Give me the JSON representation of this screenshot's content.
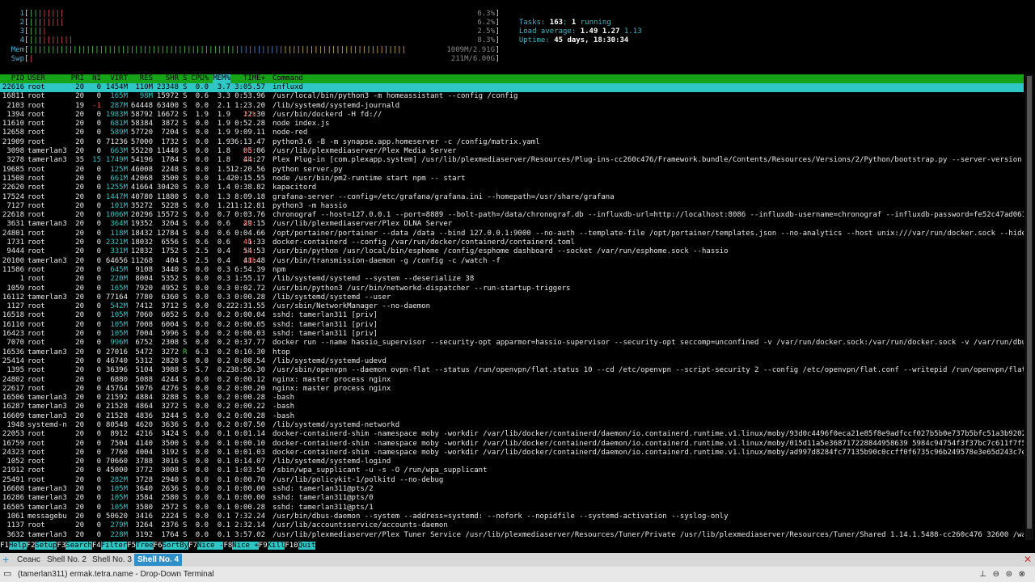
{
  "meters": {
    "cpus": [
      {
        "label": "1",
        "value": "6.3%"
      },
      {
        "label": "2",
        "value": "6.2%"
      },
      {
        "label": "3",
        "value": "2.5%"
      },
      {
        "label": "4",
        "value": "8.3%"
      }
    ],
    "mem": {
      "label": "Mem",
      "value": "1009M/2.91G"
    },
    "swp": {
      "label": "Swp",
      "value": "211M/6.00G"
    }
  },
  "info": {
    "tasks_label": "Tasks:",
    "tasks_count": "163",
    "tasks_sep": ";",
    "running_count": "1",
    "running_label": "running",
    "load_label": "Load average:",
    "load1": "1.49",
    "load5": "1.27",
    "load15": "1.13",
    "uptime_label": "Uptime:",
    "uptime_value": "45 days, 18:30:34"
  },
  "header": {
    "pid": "PID",
    "user": "USER",
    "pri": "PRI",
    "ni": "NI",
    "virt": "VIRT",
    "res": "RES",
    "shr": "SHR",
    "s": "S",
    "cpu": "CPU%",
    "mem": "MEM%",
    "time": "TIME+",
    "command": "Command"
  },
  "processes": [
    {
      "pid": "22616",
      "user": "root",
      "pri": "20",
      "ni": "0",
      "virt": "1454M",
      "res": "110M",
      "shr": "23348",
      "s": "S",
      "cpu": "0.0",
      "mem": "3.7",
      "time": "3:05.57",
      "cmd": "influxd"
    },
    {
      "pid": "16811",
      "user": "root",
      "pri": "20",
      "ni": "0",
      "virt": "165M",
      "res": "98M",
      "shr": "15972",
      "s": "S",
      "cpu": "0.6",
      "mem": "3.3",
      "time": "0:53.96",
      "cmd": "/usr/local/bin/python3 -m homeassistant --config /config"
    },
    {
      "pid": "2103",
      "user": "root",
      "pri": "19",
      "ni": "-1",
      "virt": "287M",
      "res": "64448",
      "shr": "63400",
      "s": "S",
      "cpu": "0.0",
      "mem": "2.1",
      "time": "1:23.20",
      "cmd": "/lib/systemd/systemd-journald"
    },
    {
      "pid": "1394",
      "user": "root",
      "pri": "20",
      "ni": "0",
      "virt": "1983M",
      "res": "58792",
      "shr": "16672",
      "s": "S",
      "cpu": "1.9",
      "mem": "1.9",
      "time": "21h12:30",
      "cmd": "/usr/bin/dockerd -H fd://"
    },
    {
      "pid": "11610",
      "user": "root",
      "pri": "20",
      "ni": "0",
      "virt": "681M",
      "res": "58384",
      "shr": "3872",
      "s": "S",
      "cpu": "0.0",
      "mem": "1.9",
      "time": "0:52.28",
      "cmd": "node index.js"
    },
    {
      "pid": "12658",
      "user": "root",
      "pri": "20",
      "ni": "0",
      "virt": "589M",
      "res": "57720",
      "shr": "7204",
      "s": "S",
      "cpu": "0.0",
      "mem": "1.9",
      "time": "9:09.11",
      "cmd": "node-red"
    },
    {
      "pid": "21909",
      "user": "root",
      "pri": "20",
      "ni": "0",
      "virt": "71236",
      "res": "57000",
      "shr": "1732",
      "s": "S",
      "cpu": "0.0",
      "mem": "1.9",
      "time": "36:13.47",
      "cmd": "python3.6 -B -m synapse.app.homeserver -c /config/matrix.yaml"
    },
    {
      "pid": "3098",
      "user": "tamerlan3",
      "pri": "20",
      "ni": "0",
      "virt": "663M",
      "res": "55220",
      "shr": "11440",
      "s": "S",
      "cpu": "0.0",
      "mem": "1.8",
      "time": "3h05:06",
      "cmd": "/usr/lib/plexmediaserver/Plex Media Server"
    },
    {
      "pid": "3278",
      "user": "tamerlan3",
      "pri": "35",
      "ni": "15",
      "virt": "1749M",
      "res": "54196",
      "shr": "1784",
      "s": "S",
      "cpu": "0.0",
      "mem": "1.8",
      "time": "2h44:27",
      "cmd": "Plex Plug-in [com.plexapp.system] /usr/lib/plexmediaserver/Resources/Plug-ins-cc260c476/Framework.bundle/Contents/Resources/Versions/2/Python/bootstrap.py --server-version 1."
    },
    {
      "pid": "19685",
      "user": "root",
      "pri": "20",
      "ni": "0",
      "virt": "125M",
      "res": "46008",
      "shr": "2248",
      "s": "S",
      "cpu": "0.0",
      "mem": "1.5",
      "time": "12:20.56",
      "cmd": "python server.py"
    },
    {
      "pid": "11508",
      "user": "root",
      "pri": "20",
      "ni": "0",
      "virt": "661M",
      "res": "42068",
      "shr": "3500",
      "s": "S",
      "cpu": "0.0",
      "mem": "1.4",
      "time": "20:15.55",
      "cmd": "node /usr/bin/pm2-runtime start npm -- start"
    },
    {
      "pid": "22620",
      "user": "root",
      "pri": "20",
      "ni": "0",
      "virt": "1255M",
      "res": "41664",
      "shr": "30420",
      "s": "S",
      "cpu": "0.0",
      "mem": "1.4",
      "time": "0:38.82",
      "cmd": "kapacitord"
    },
    {
      "pid": "17524",
      "user": "root",
      "pri": "20",
      "ni": "0",
      "virt": "1447M",
      "res": "40780",
      "shr": "11880",
      "s": "S",
      "cpu": "0.0",
      "mem": "1.3",
      "time": "8:09.18",
      "cmd": "grafana-server --config=/etc/grafana/grafana.ini --homepath=/usr/share/grafana"
    },
    {
      "pid": "7127",
      "user": "root",
      "pri": "20",
      "ni": "0",
      "virt": "101M",
      "res": "35272",
      "shr": "5228",
      "s": "S",
      "cpu": "0.0",
      "mem": "1.2",
      "time": "11:12.81",
      "cmd": "python3 -m hassio"
    },
    {
      "pid": "22618",
      "user": "root",
      "pri": "20",
      "ni": "0",
      "virt": "1006M",
      "res": "20296",
      "shr": "15572",
      "s": "S",
      "cpu": "0.0",
      "mem": "0.7",
      "time": "0:03.76",
      "cmd": "chronograf --host=127.0.0.1 --port=8889 --bolt-path=/data/chronograf.db --influxdb-url=http://localhost:8086 --influxdb-username=chronograf --influxdb-password=fe52c47ad06147"
    },
    {
      "pid": "3631",
      "user": "tamerlan3",
      "pri": "20",
      "ni": "0",
      "virt": "364M",
      "res": "19352",
      "shr": "3204",
      "s": "S",
      "cpu": "0.0",
      "mem": "0.6",
      "time": "4h29:15",
      "cmd": "/usr/lib/plexmediaserver/Plex DLNA Server"
    },
    {
      "pid": "24801",
      "user": "root",
      "pri": "20",
      "ni": "0",
      "virt": "118M",
      "res": "18432",
      "shr": "12784",
      "s": "S",
      "cpu": "0.0",
      "mem": "0.6",
      "time": "0:04.66",
      "cmd": "/opt/portainer/portainer --data /data --bind 127.0.0.1:9000 --no-auth --template-file /opt/portainer/templates.json --no-analytics --host unix:///var/run/docker.sock --hide-l"
    },
    {
      "pid": "1731",
      "user": "root",
      "pri": "20",
      "ni": "0",
      "virt": "2321M",
      "res": "18032",
      "shr": "6556",
      "s": "S",
      "cpu": "0.6",
      "mem": "0.6",
      "time": "4h41:33",
      "cmd": "docker-containerd --config /var/run/docker/containerd/containerd.toml"
    },
    {
      "pid": "9444",
      "user": "root",
      "pri": "20",
      "ni": "0",
      "virt": "331M",
      "res": "12832",
      "shr": "1752",
      "s": "S",
      "cpu": "2.5",
      "mem": "0.4",
      "time": "1h54:53",
      "cmd": "/usr/bin/python /usr/local/bin/esphome /config/esphome dashboard --socket /var/run/esphome.sock --hassio"
    },
    {
      "pid": "20100",
      "user": "tamerlan3",
      "pri": "20",
      "ni": "0",
      "virt": "64656",
      "res": "11268",
      "shr": "404",
      "s": "S",
      "cpu": "2.5",
      "mem": "0.4",
      "time": "18h41:48",
      "cmd": "/usr/bin/transmission-daemon -g /config -c /watch -f"
    },
    {
      "pid": "11586",
      "user": "root",
      "pri": "20",
      "ni": "0",
      "virt": "645M",
      "res": "9108",
      "shr": "3440",
      "s": "S",
      "cpu": "0.0",
      "mem": "0.3",
      "time": "6:54.39",
      "cmd": "npm"
    },
    {
      "pid": "1",
      "user": "root",
      "pri": "20",
      "ni": "0",
      "virt": "220M",
      "res": "8004",
      "shr": "5352",
      "s": "S",
      "cpu": "0.0",
      "mem": "0.3",
      "time": "1:55.17",
      "cmd": "/lib/systemd/systemd --system --deserialize 38"
    },
    {
      "pid": "1059",
      "user": "root",
      "pri": "20",
      "ni": "0",
      "virt": "165M",
      "res": "7920",
      "shr": "4952",
      "s": "S",
      "cpu": "0.0",
      "mem": "0.3",
      "time": "0:02.72",
      "cmd": "/usr/bin/python3 /usr/bin/networkd-dispatcher --run-startup-triggers"
    },
    {
      "pid": "16112",
      "user": "tamerlan3",
      "pri": "20",
      "ni": "0",
      "virt": "77164",
      "res": "7780",
      "shr": "6360",
      "s": "S",
      "cpu": "0.0",
      "mem": "0.3",
      "time": "0:00.28",
      "cmd": "/lib/systemd/systemd --user"
    },
    {
      "pid": "1127",
      "user": "root",
      "pri": "20",
      "ni": "0",
      "virt": "542M",
      "res": "7412",
      "shr": "3712",
      "s": "S",
      "cpu": "0.0",
      "mem": "0.2",
      "time": "22:31.55",
      "cmd": "/usr/sbin/NetworkManager --no-daemon"
    },
    {
      "pid": "16518",
      "user": "root",
      "pri": "20",
      "ni": "0",
      "virt": "105M",
      "res": "7060",
      "shr": "6052",
      "s": "S",
      "cpu": "0.0",
      "mem": "0.2",
      "time": "0:00.04",
      "cmd": "sshd: tamerlan311 [priv]"
    },
    {
      "pid": "16110",
      "user": "root",
      "pri": "20",
      "ni": "0",
      "virt": "105M",
      "res": "7008",
      "shr": "6004",
      "s": "S",
      "cpu": "0.0",
      "mem": "0.2",
      "time": "0:00.05",
      "cmd": "sshd: tamerlan311 [priv]"
    },
    {
      "pid": "16423",
      "user": "root",
      "pri": "20",
      "ni": "0",
      "virt": "105M",
      "res": "7004",
      "shr": "5996",
      "s": "S",
      "cpu": "0.0",
      "mem": "0.2",
      "time": "0:00.03",
      "cmd": "sshd: tamerlan311 [priv]"
    },
    {
      "pid": "7070",
      "user": "root",
      "pri": "20",
      "ni": "0",
      "virt": "996M",
      "res": "6752",
      "shr": "2308",
      "s": "S",
      "cpu": "0.0",
      "mem": "0.2",
      "time": "0:37.77",
      "cmd": "docker run --name hassio_supervisor --security-opt apparmor=hassio-supervisor --security-opt seccomp=unconfined -v /var/run/docker.sock:/var/run/docker.sock -v /var/run/dbus:"
    },
    {
      "pid": "16536",
      "user": "tamerlan3",
      "pri": "20",
      "ni": "0",
      "virt": "27016",
      "res": "5472",
      "shr": "3272",
      "s": "R",
      "cpu": "6.3",
      "mem": "0.2",
      "time": "0:10.30",
      "cmd": "htop"
    },
    {
      "pid": "25414",
      "user": "root",
      "pri": "20",
      "ni": "0",
      "virt": "46740",
      "res": "5312",
      "shr": "2820",
      "s": "S",
      "cpu": "0.0",
      "mem": "0.2",
      "time": "0:08.54",
      "cmd": "/lib/systemd/systemd-udevd"
    },
    {
      "pid": "1395",
      "user": "root",
      "pri": "20",
      "ni": "0",
      "virt": "36396",
      "res": "5104",
      "shr": "3988",
      "s": "S",
      "cpu": "5.7",
      "mem": "0.2",
      "time": "38:56.30",
      "cmd": "/usr/sbin/openvpn --daemon ovpn-flat --status /run/openvpn/flat.status 10 --cd /etc/openvpn --script-security 2 --config /etc/openvpn/flat.conf --writepid /run/openvpn/flat.p"
    },
    {
      "pid": "24802",
      "user": "root",
      "pri": "20",
      "ni": "0",
      "virt": "6880",
      "res": "5088",
      "shr": "4244",
      "s": "S",
      "cpu": "0.0",
      "mem": "0.2",
      "time": "0:00.12",
      "cmd": "nginx: master process nginx"
    },
    {
      "pid": "22617",
      "user": "root",
      "pri": "20",
      "ni": "0",
      "virt": "45764",
      "res": "5076",
      "shr": "4276",
      "s": "S",
      "cpu": "0.0",
      "mem": "0.2",
      "time": "0:00.20",
      "cmd": "nginx: master process nginx"
    },
    {
      "pid": "16506",
      "user": "tamerlan3",
      "pri": "20",
      "ni": "0",
      "virt": "21592",
      "res": "4884",
      "shr": "3288",
      "s": "S",
      "cpu": "0.0",
      "mem": "0.2",
      "time": "0:00.28",
      "cmd": "-bash"
    },
    {
      "pid": "16287",
      "user": "tamerlan3",
      "pri": "20",
      "ni": "0",
      "virt": "21528",
      "res": "4864",
      "shr": "3272",
      "s": "S",
      "cpu": "0.0",
      "mem": "0.2",
      "time": "0:00.22",
      "cmd": "-bash"
    },
    {
      "pid": "16609",
      "user": "tamerlan3",
      "pri": "20",
      "ni": "0",
      "virt": "21528",
      "res": "4836",
      "shr": "3244",
      "s": "S",
      "cpu": "0.0",
      "mem": "0.2",
      "time": "0:00.28",
      "cmd": "-bash"
    },
    {
      "pid": "1948",
      "user": "systemd-n",
      "pri": "20",
      "ni": "0",
      "virt": "80548",
      "res": "4620",
      "shr": "3636",
      "s": "S",
      "cpu": "0.0",
      "mem": "0.2",
      "time": "0:07.50",
      "cmd": "/lib/systemd/systemd-networkd"
    },
    {
      "pid": "22053",
      "user": "root",
      "pri": "20",
      "ni": "0",
      "virt": "8912",
      "res": "4216",
      "shr": "3424",
      "s": "S",
      "cpu": "0.0",
      "mem": "0.1",
      "time": "0:01.14",
      "cmd": "docker-containerd-shim -namespace moby -workdir /var/lib/docker/containerd/daemon/io.containerd.runtime.v1.linux/moby/93d0c4496f0eca21e85f8e9adfccf027b5b0e737b5bfc51a3b920200"
    },
    {
      "pid": "16759",
      "user": "root",
      "pri": "20",
      "ni": "0",
      "virt": "7504",
      "res": "4140",
      "shr": "3500",
      "s": "S",
      "cpu": "0.0",
      "mem": "0.1",
      "time": "0:00.10",
      "cmd": "docker-containerd-shim -namespace moby -workdir /var/lib/docker/containerd/daemon/io.containerd.runtime.v1.linux/moby/015d11a5e368717228844958639 5984c94754f3f37bc7c611f7f528"
    },
    {
      "pid": "24323",
      "user": "root",
      "pri": "20",
      "ni": "0",
      "virt": "7760",
      "res": "4004",
      "shr": "3192",
      "s": "S",
      "cpu": "0.0",
      "mem": "0.1",
      "time": "0:01.03",
      "cmd": "docker-containerd-shim -namespace moby -workdir /var/lib/docker/containerd/daemon/io.containerd.runtime.v1.linux/moby/ad997d8284fc77135b90c0ccff0f6735c96b249578e3e65d243c7e70"
    },
    {
      "pid": "1052",
      "user": "root",
      "pri": "20",
      "ni": "0",
      "virt": "70660",
      "res": "3788",
      "shr": "3016",
      "s": "S",
      "cpu": "0.0",
      "mem": "0.1",
      "time": "0:14.07",
      "cmd": "/lib/systemd/systemd-logind"
    },
    {
      "pid": "21912",
      "user": "root",
      "pri": "20",
      "ni": "0",
      "virt": "45000",
      "res": "3772",
      "shr": "3008",
      "s": "S",
      "cpu": "0.0",
      "mem": "0.1",
      "time": "1:03.50",
      "cmd": "/sbin/wpa_supplicant -u -s -O /run/wpa_supplicant"
    },
    {
      "pid": "25491",
      "user": "root",
      "pri": "20",
      "ni": "0",
      "virt": "282M",
      "res": "3728",
      "shr": "2940",
      "s": "S",
      "cpu": "0.0",
      "mem": "0.1",
      "time": "0:00.70",
      "cmd": "/usr/lib/policykit-1/polkitd --no-debug"
    },
    {
      "pid": "16608",
      "user": "tamerlan3",
      "pri": "20",
      "ni": "0",
      "virt": "105M",
      "res": "3640",
      "shr": "2636",
      "s": "S",
      "cpu": "0.0",
      "mem": "0.1",
      "time": "0:00.00",
      "cmd": "sshd: tamerlan311@pts/2"
    },
    {
      "pid": "16286",
      "user": "tamerlan3",
      "pri": "20",
      "ni": "0",
      "virt": "105M",
      "res": "3584",
      "shr": "2580",
      "s": "S",
      "cpu": "0.0",
      "mem": "0.1",
      "time": "0:00.00",
      "cmd": "sshd: tamerlan311@pts/0"
    },
    {
      "pid": "16505",
      "user": "tamerlan3",
      "pri": "20",
      "ni": "0",
      "virt": "105M",
      "res": "3580",
      "shr": "2572",
      "s": "S",
      "cpu": "0.0",
      "mem": "0.1",
      "time": "0:00.28",
      "cmd": "sshd: tamerlan311@pts/1"
    },
    {
      "pid": "1061",
      "user": "messagebu",
      "pri": "20",
      "ni": "0",
      "virt": "50620",
      "res": "3416",
      "shr": "2224",
      "s": "S",
      "cpu": "0.0",
      "mem": "0.1",
      "time": "7:32.24",
      "cmd": "/usr/bin/dbus-daemon --system --address=systemd: --nofork --nopidfile --systemd-activation --syslog-only"
    },
    {
      "pid": "1137",
      "user": "root",
      "pri": "20",
      "ni": "0",
      "virt": "279M",
      "res": "3264",
      "shr": "2376",
      "s": "S",
      "cpu": "0.0",
      "mem": "0.1",
      "time": "2:32.14",
      "cmd": "/usr/lib/accountsservice/accounts-daemon"
    },
    {
      "pid": "3632",
      "user": "tamerlan3",
      "pri": "20",
      "ni": "0",
      "virt": "228M",
      "res": "3192",
      "shr": "1764",
      "s": "S",
      "cpu": "0.0",
      "mem": "0.1",
      "time": "3:57.02",
      "cmd": "/usr/lib/plexmediaserver/Plex Tuner Service /usr/lib/plexmediaserver/Resources/Tuner/Private /usr/lib/plexmediaserver/Resources/Tuner/Shared 1.14.1.5488-cc260c476 32600 /wait"
    }
  ],
  "fkeys": [
    {
      "num": "F1",
      "label": "Help"
    },
    {
      "num": "F2",
      "label": "Setup"
    },
    {
      "num": "F3",
      "label": "Search"
    },
    {
      "num": "F4",
      "label": "Filter"
    },
    {
      "num": "F5",
      "label": "Tree"
    },
    {
      "num": "F6",
      "label": "SortBy"
    },
    {
      "num": "F7",
      "label": "Nice -"
    },
    {
      "num": "F8",
      "label": "Nice +"
    },
    {
      "num": "F9",
      "label": "Kill"
    },
    {
      "num": "F10",
      "label": "Quit"
    }
  ],
  "tabs": [
    {
      "label": "Сеанс"
    },
    {
      "label": "Shell No. 2"
    },
    {
      "label": "Shell No. 3"
    },
    {
      "label": "Shell No. 4",
      "active": true
    }
  ],
  "window_title": "(tamerlan311) ermak.tetra.name - Drop-Down Terminal",
  "colors": {
    "header_bg": "#17a317",
    "selected_bg": "#2fc6c6",
    "tab_active": "#2f8fc8"
  }
}
